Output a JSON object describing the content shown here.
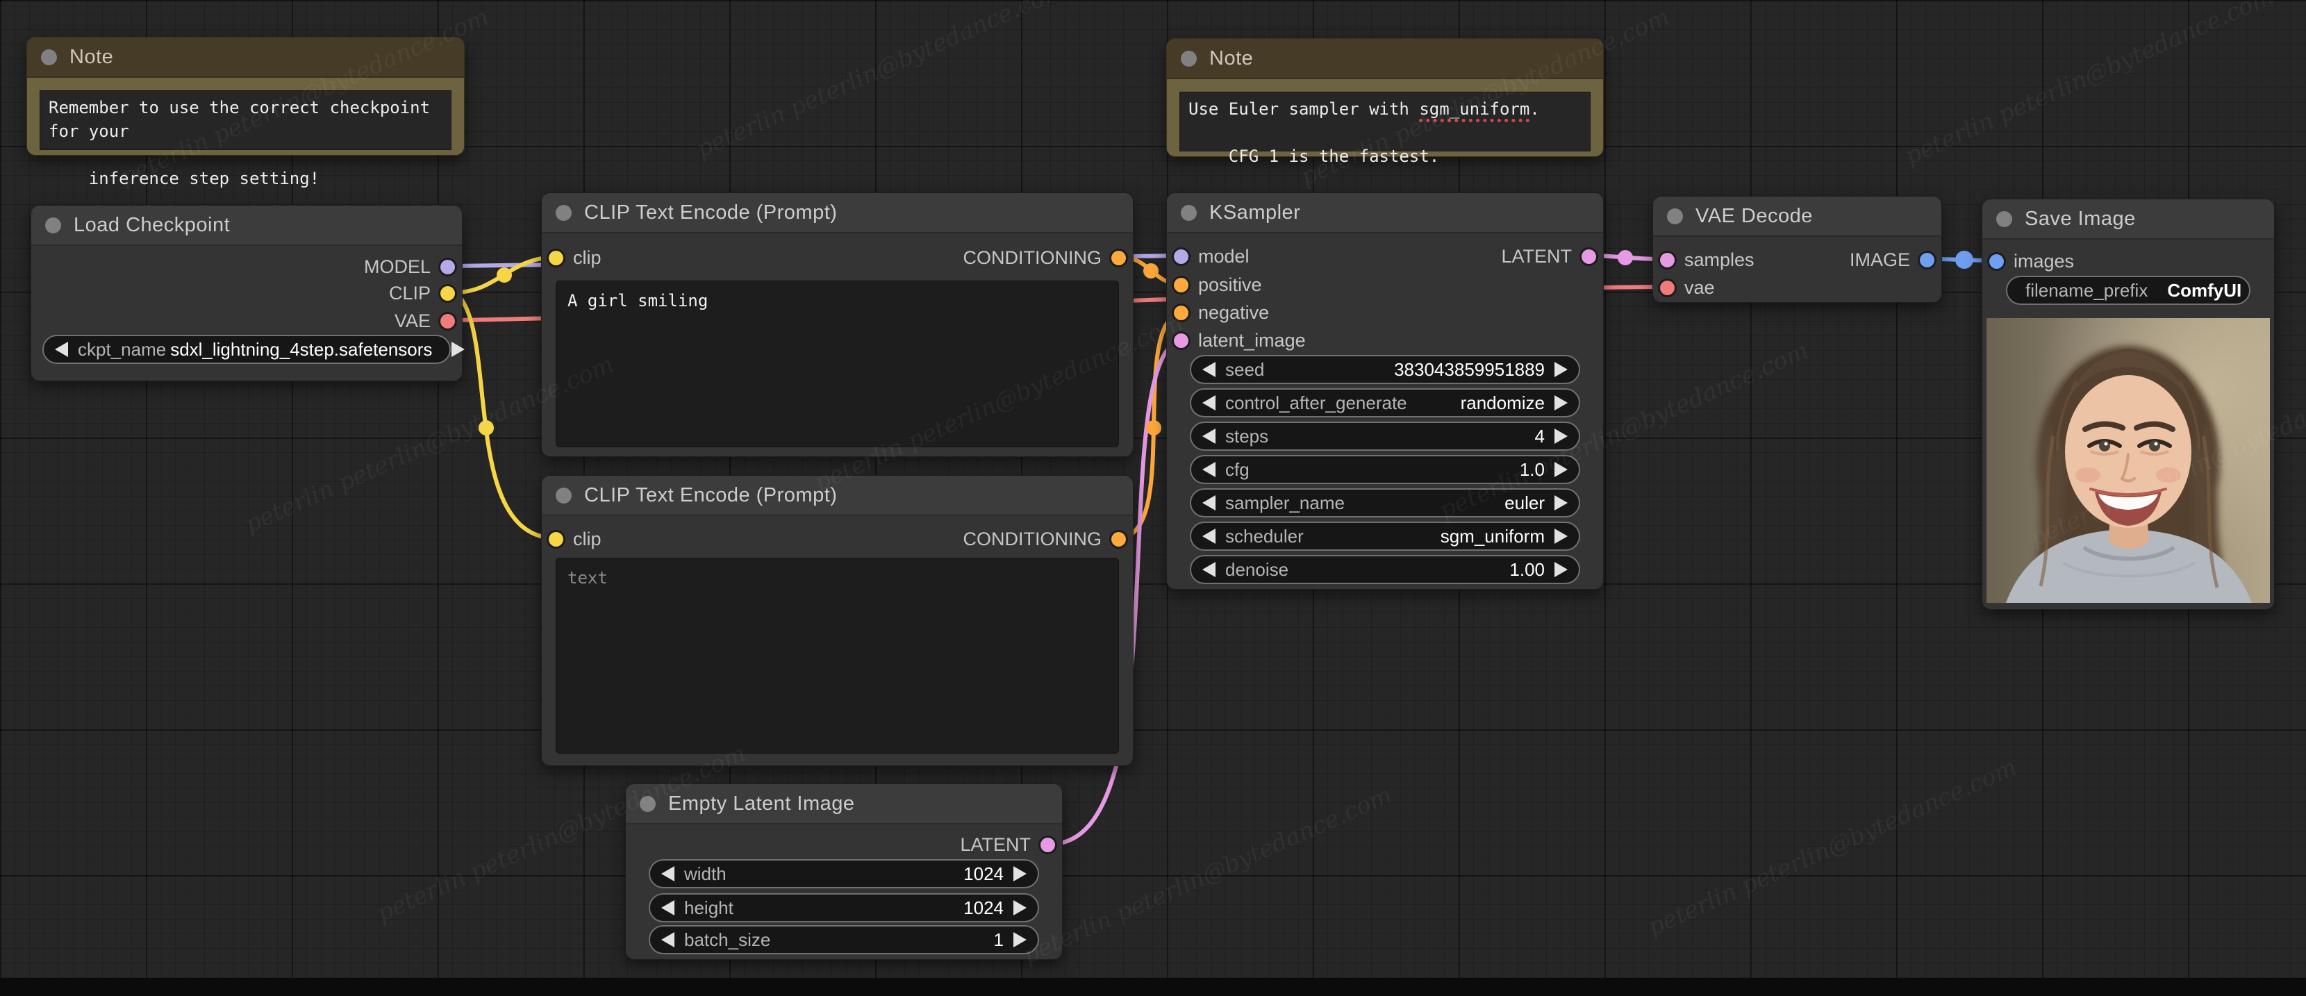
{
  "watermark": {
    "text": "peterlin peterlin@bytedance.com"
  },
  "notes": [
    {
      "title": "Note",
      "line1": "Remember to use the correct checkpoint for your",
      "line2": "inference step setting!"
    },
    {
      "title": "Note",
      "line1_prefix": "Use Euler sampler with ",
      "line1_word": "sgm_uniform",
      "line1_suffix": ".",
      "line2": "CFG 1 is the fastest."
    }
  ],
  "nodes": {
    "load_checkpoint": {
      "title": "Load Checkpoint",
      "outputs": [
        "MODEL",
        "CLIP",
        "VAE"
      ],
      "widget": {
        "label": "ckpt_name",
        "value": "sdxl_lightning_4step.safetensors"
      }
    },
    "clip_positive": {
      "title": "CLIP Text Encode (Prompt)",
      "input": "clip",
      "output": "CONDITIONING",
      "text": "A girl smiling"
    },
    "clip_negative": {
      "title": "CLIP Text Encode (Prompt)",
      "input": "clip",
      "output": "CONDITIONING",
      "placeholder": "text"
    },
    "ksampler": {
      "title": "KSampler",
      "inputs": [
        "model",
        "positive",
        "negative",
        "latent_image"
      ],
      "output": "LATENT",
      "widgets": [
        {
          "label": "seed",
          "value": "383043859951889"
        },
        {
          "label": "control_after_generate",
          "value": "randomize"
        },
        {
          "label": "steps",
          "value": "4"
        },
        {
          "label": "cfg",
          "value": "1.0"
        },
        {
          "label": "sampler_name",
          "value": "euler"
        },
        {
          "label": "scheduler",
          "value": "sgm_uniform"
        },
        {
          "label": "denoise",
          "value": "1.00"
        }
      ]
    },
    "vae_decode": {
      "title": "VAE Decode",
      "inputs": [
        "samples",
        "vae"
      ],
      "output": "IMAGE"
    },
    "save_image": {
      "title": "Save Image",
      "input": "images",
      "widget": {
        "label": "filename_prefix",
        "value": "ComfyUI"
      }
    },
    "empty_latent": {
      "title": "Empty Latent Image",
      "output": "LATENT",
      "widgets": [
        {
          "label": "width",
          "value": "1024"
        },
        {
          "label": "height",
          "value": "1024"
        },
        {
          "label": "batch_size",
          "value": "1"
        }
      ]
    }
  },
  "colors": {
    "model": "#b7a8e8",
    "clip": "#f6d645",
    "vae": "#ef7b7b",
    "conditioning": "#ffa93c",
    "latent": "#e79ae4",
    "image": "#6f9ff0",
    "node_bg": "#343434",
    "node_header": "#3c3c3c",
    "note_bg": "#6e6340",
    "note_header": "#463b26",
    "canvas": "#262626"
  }
}
